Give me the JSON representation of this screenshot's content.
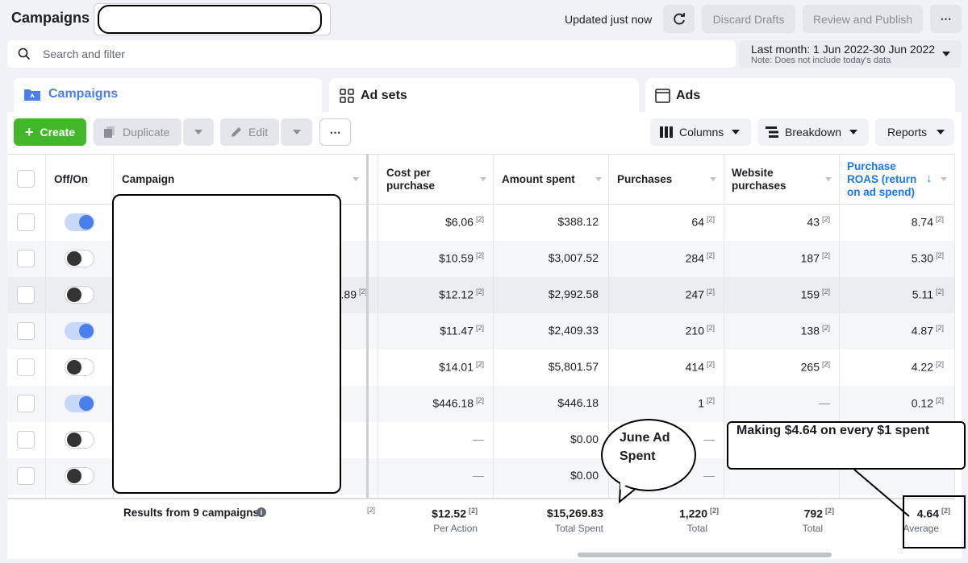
{
  "header": {
    "title": "Campaigns",
    "updated": "Updated just now",
    "discard": "Discard Drafts",
    "review": "Review and Publish",
    "more": "⋯"
  },
  "search": {
    "placeholder": "Search and filter"
  },
  "date": {
    "range": "Last month: 1 Jun 2022-30 Jun 2022",
    "note": "Note: Does not include today's data"
  },
  "tabs": [
    {
      "label": "Campaigns"
    },
    {
      "label": "Ad sets"
    },
    {
      "label": "Ads"
    }
  ],
  "toolbar": {
    "create": "Create",
    "duplicate": "Duplicate",
    "edit": "Edit",
    "more": "⋯",
    "columns": "Columns",
    "breakdown": "Breakdown",
    "reports": "Reports"
  },
  "columns": {
    "onoff": "Off/On",
    "campaign": "Campaign",
    "cost": "Cost per purchase",
    "amount": "Amount spent",
    "purchases": "Purchases",
    "website": "Website purchases",
    "roas": "Purchase ROAS (return on ad spend)"
  },
  "footnote_mark": "[2]",
  "rows": [
    {
      "on": true,
      "partial": "",
      "cost": "$6.06",
      "amount": "$388.12",
      "purchases": "64",
      "website": "43",
      "roas": "8.74"
    },
    {
      "on": false,
      "partial": "",
      "cost": "$10.59",
      "amount": "$3,007.52",
      "purchases": "284",
      "website": "187",
      "roas": "5.30"
    },
    {
      "on": false,
      "partial": ".89",
      "cost": "$12.12",
      "amount": "$2,992.58",
      "purchases": "247",
      "website": "159",
      "roas": "5.11"
    },
    {
      "on": true,
      "partial": "",
      "cost": "$11.47",
      "amount": "$2,409.33",
      "purchases": "210",
      "website": "138",
      "roas": "4.87"
    },
    {
      "on": false,
      "partial": "",
      "cost": "$14.01",
      "amount": "$5,801.57",
      "purchases": "414",
      "website": "265",
      "roas": "4.22"
    },
    {
      "on": true,
      "partial": "",
      "cost": "$446.18",
      "amount": "$446.18",
      "purchases": "1",
      "website": "—",
      "roas": "0.12"
    },
    {
      "on": false,
      "partial": "",
      "cost": "—",
      "amount": "$0.00",
      "purchases": "—",
      "website": "",
      "roas": ""
    },
    {
      "on": false,
      "partial": "",
      "cost": "—",
      "amount": "$0.00",
      "purchases": "—",
      "website": "",
      "roas": ""
    }
  ],
  "footer": {
    "results": "Results from 9 campaigns",
    "cost": "$12.52",
    "cost_sub": "Per Action",
    "amount": "$15,269.83",
    "amount_sub": "Total Spent",
    "purchases": "1,220",
    "purchases_sub": "Total",
    "website": "792",
    "website_sub": "Total",
    "roas": "4.64",
    "roas_sub": "Average"
  },
  "annotations": {
    "bubble": "June Ad Spent",
    "note": "Making $4.64 on every $1 spent"
  },
  "colors": {
    "accent": "#4a7ee8",
    "create_green": "#42b72a",
    "roas_header": "#1877f2"
  }
}
